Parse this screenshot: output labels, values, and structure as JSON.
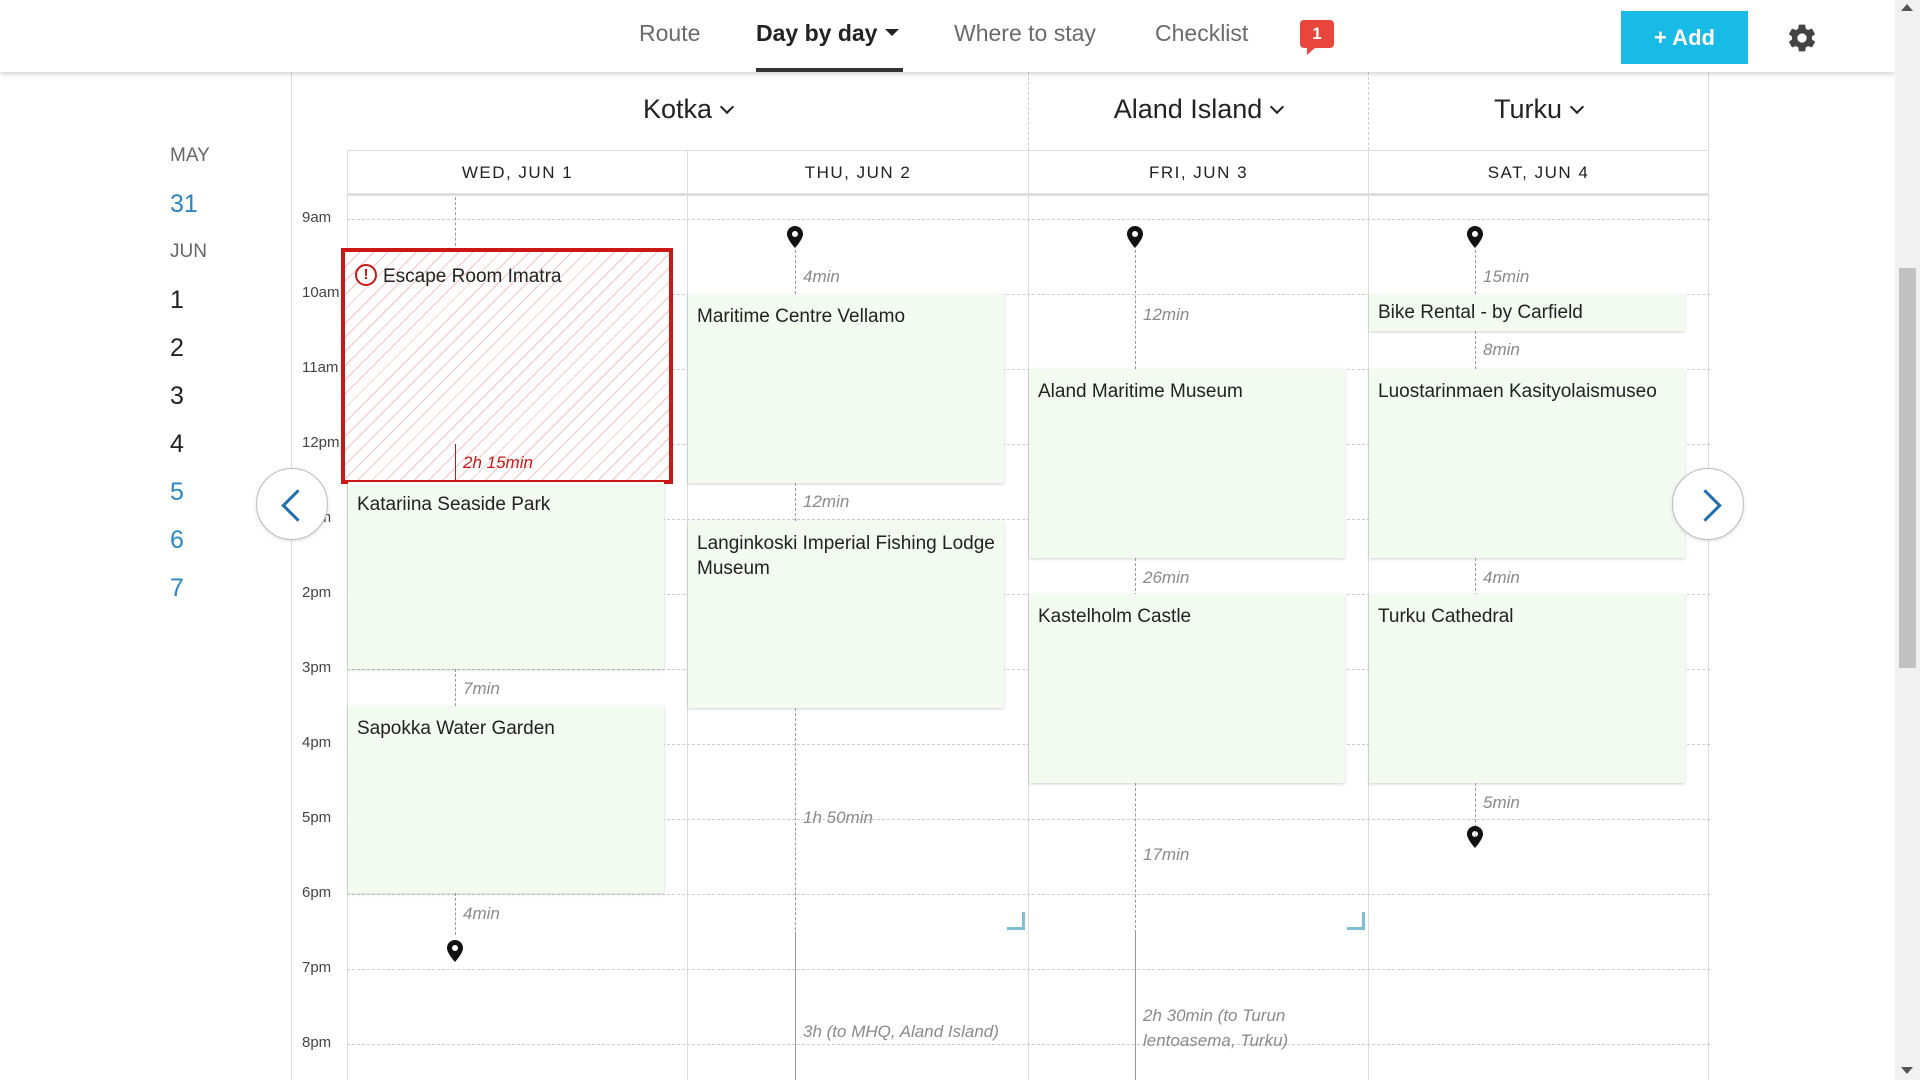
{
  "nav": {
    "route": "Route",
    "day_by_day": "Day by day",
    "where_to_stay": "Where to stay",
    "checklist": "Checklist",
    "notification_count": "1",
    "add_button": "+ Add",
    "accent_color": "#17bbe5",
    "icons": {
      "dropdown": "caret-down-icon",
      "settings": "gear-icon",
      "notification": "speech-bubble-badge-icon"
    }
  },
  "date_rail": {
    "month1": "MAY",
    "may_days": [
      "31"
    ],
    "month2": "JUN",
    "jun_days": [
      "1",
      "2",
      "3",
      "4",
      "5",
      "6",
      "7"
    ]
  },
  "cities": [
    {
      "name": "Kotka"
    },
    {
      "name": "Aland Island"
    },
    {
      "name": "Turku"
    }
  ],
  "days": [
    "WED, JUN 1",
    "THU, JUN 2",
    "FRI, JUN 3",
    "SAT, JUN 4"
  ],
  "hours": [
    "9am",
    "10am",
    "11am",
    "12pm",
    "1pm",
    "2pm",
    "3pm",
    "4pm",
    "5pm",
    "6pm",
    "7pm",
    "8pm"
  ],
  "schedule": {
    "wed": {
      "conflict_event": "Escape Room Imatra",
      "conflict_duration": "2h 15min",
      "events": [
        "Katariina Seaside Park",
        "Sapokka Water Garden"
      ],
      "travel": [
        "7min",
        "4min"
      ]
    },
    "thu": {
      "events": [
        "Maritime Centre Vellamo",
        "Langinkoski Imperial Fishing Lodge Museum"
      ],
      "travel": [
        "4min",
        "12min",
        "1h 50min",
        "3h (to MHQ, Aland Island)"
      ]
    },
    "fri": {
      "events": [
        "Aland Maritime Museum",
        "Kastelholm Castle"
      ],
      "travel": [
        "12min",
        "26min",
        "17min",
        "2h 30min (to Turun lentoasema, Turku)"
      ]
    },
    "sat": {
      "events": [
        "Bike Rental - by Carfield",
        "Luostarinmaen Kasityolaismuseo",
        "Turku Cathedral"
      ],
      "travel": [
        "15min",
        "8min",
        "4min",
        "5min"
      ]
    }
  },
  "colors": {
    "event_bg": "#f3faf0",
    "conflict": "#cc1717",
    "link_blue": "#2a87c4"
  }
}
